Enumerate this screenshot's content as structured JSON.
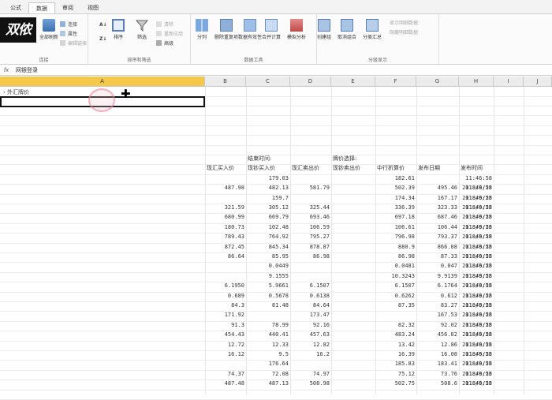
{
  "tabs": [
    "公式",
    "数据",
    "审阅",
    "视图"
  ],
  "active_tab": 1,
  "logo_text": "双侬",
  "ribbon": {
    "groups": [
      {
        "label": "连接",
        "buttons": [
          "全部刷新"
        ],
        "small": [
          "连接",
          "属性",
          "编辑链接"
        ]
      },
      {
        "label": "排序和筛选",
        "buttons": [
          "排序",
          "筛选"
        ],
        "small": [
          "清除",
          "重新应用",
          "高级"
        ]
      },
      {
        "label": "数据工具",
        "buttons": [
          "分列",
          "删除重复项",
          "数据有效性",
          "合并计算",
          "模拟分析"
        ]
      },
      {
        "label": "分级显示",
        "buttons": [
          "创建组",
          "取消组合",
          "分类汇总"
        ],
        "small": [
          "显示明细数据",
          "隐藏明细数据"
        ]
      }
    ]
  },
  "formula_bar": {
    "fx": "fx",
    "value": "网银登录"
  },
  "columns": [
    "A",
    "B",
    "C",
    "D",
    "E",
    "F",
    "G",
    "H",
    "I",
    "J"
  ],
  "a1_text": "外汇牌价",
  "table": {
    "row1": [
      "",
      "结束时间:",
      "",
      "牌价选择:",
      "",
      "",
      ""
    ],
    "headers": [
      "现汇买入价",
      "现钞买入价",
      "现汇卖出价",
      "现钞卖出价",
      "中行折算价",
      "发布日期",
      "发布时间"
    ],
    "rows": [
      [
        "",
        "179.03",
        "",
        "",
        "182.61",
        "",
        ""
      ],
      [
        "487.98",
        "482.13",
        "581.79",
        "",
        "502.39",
        "495.46",
        "2018/9/25"
      ],
      [
        "",
        "159.7",
        "",
        "",
        "174.34",
        "167.17",
        "2018/9/25"
      ],
      [
        "321.59",
        "305.12",
        "325.44",
        "",
        "336.39",
        "323.33",
        "2018/9/25"
      ],
      [
        "680.99",
        "669.79",
        "693.46",
        "",
        "697.18",
        "687.46",
        "2018/9/25"
      ],
      [
        "180.73",
        "102.48",
        "106.59",
        "",
        "106.61",
        "106.44",
        "2018/9/25"
      ],
      [
        "789.43",
        "764.92",
        "795.27",
        "",
        "796.98",
        "793.37",
        "2018/9/25"
      ],
      [
        "872.45",
        "845.34",
        "878.87",
        "",
        "880.9",
        "866.08",
        "2018/9/25"
      ],
      [
        "86.64",
        "85.95",
        "86.98",
        "",
        "86.98",
        "87.33",
        "2018/9/25"
      ],
      [
        "",
        "0.0449",
        "",
        "",
        "0.0481",
        "0.047",
        "2018/9/25"
      ],
      [
        "",
        "9.1555",
        "",
        "",
        "10.3243",
        "9.9139",
        "2018/9/25"
      ],
      [
        "6.1950",
        "5.9661",
        "6.1507",
        "",
        "6.1507",
        "6.1764",
        "2018/9/25"
      ],
      [
        "0.689",
        "0.5678",
        "0.6138",
        "",
        "0.6262",
        "0.612",
        "2018/9/25"
      ],
      [
        "84.3",
        "81.48",
        "84.64",
        "",
        "87.35",
        "83.27",
        "2018/9/25"
      ],
      [
        "171.92",
        "",
        "173.47",
        "",
        "",
        "167.53",
        "2018/9/25"
      ],
      [
        "91.3",
        "78.99",
        "92.16",
        "",
        "82.32",
        "92.02",
        "2018/9/25"
      ],
      [
        "454.43",
        "440.41",
        "457.63",
        "",
        "483.24",
        "456.02",
        "2018/9/25"
      ],
      [
        "12.72",
        "12.33",
        "12.82",
        "",
        "13.42",
        "12.86",
        "2018/9/25"
      ],
      [
        "16.12",
        "9.5",
        "16.2",
        "",
        "16.39",
        "16.08",
        "2018/9/25"
      ],
      [
        "",
        "176.64",
        "",
        "",
        "185.83",
        "183.41",
        "2018/9/25"
      ],
      [
        "74.37",
        "72.08",
        "74.97",
        "",
        "75.12",
        "73.76",
        "2018/9/25"
      ],
      [
        "487.48",
        "487.13",
        "508.98",
        "",
        "502.75",
        "508.6",
        "2018/9/25"
      ]
    ],
    "time_value": "11:46:58"
  }
}
